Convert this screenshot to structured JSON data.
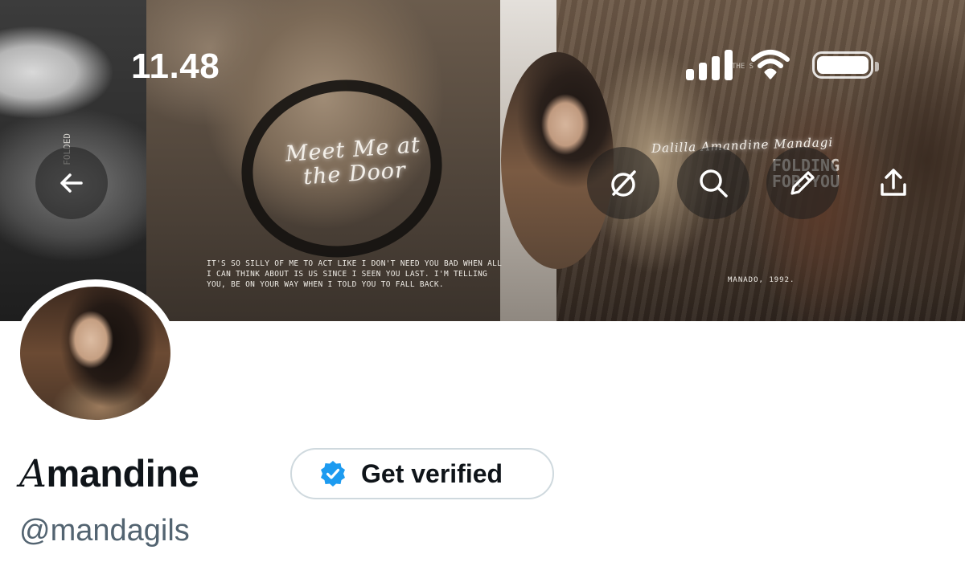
{
  "status_bar": {
    "time": "11.48"
  },
  "header": {
    "banner_text": {
      "script_title": "Meet Me at the Door",
      "lyrics": "IT'S SO SILLY OF ME TO ACT LIKE I DON'T NEED YOU BAD WHEN ALL I CAN THINK ABOUT IS US SINCE I SEEN YOU LAST. I'M TELLING YOU, BE ON YOUR WAY WHEN I TOLD YOU TO FALL BACK.",
      "signature": "Dalilla Amandine Mandagi",
      "folding": "FOLDING FOR YOU",
      "location_year": "MANADO, 1992.",
      "small_top": "THE S",
      "vertical": "FOLDED"
    },
    "actions": {
      "back": "back-arrow-icon",
      "grok": "grok-icon",
      "search": "search-icon",
      "edit": "pencil-icon",
      "share": "share-icon"
    }
  },
  "profile": {
    "display_name_first": "A",
    "display_name_rest": "mandine",
    "verify_label": "Get verified",
    "handle": "@mandagils"
  },
  "colors": {
    "verified_badge": "#1d9bf0",
    "text_primary": "#0f1419",
    "text_secondary": "#536471",
    "pill_border": "#cfd9de"
  }
}
